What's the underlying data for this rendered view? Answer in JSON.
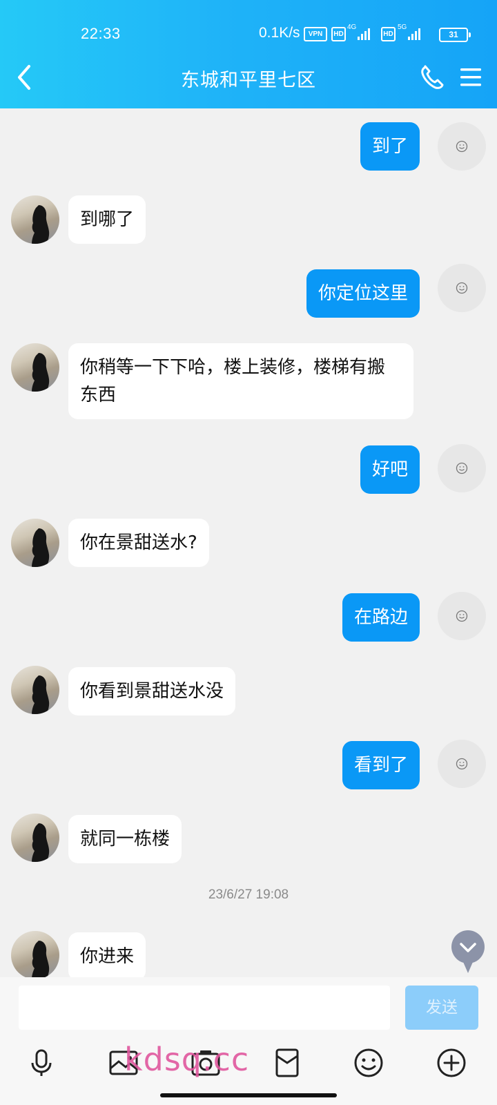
{
  "status_bar": {
    "time": "22:33",
    "net_speed": "0.1K/s",
    "vpn": "VPN",
    "hd1": "HD",
    "net1": "4G",
    "hd2": "HD",
    "net2": "5G",
    "battery": "31"
  },
  "header": {
    "title": "东城和平里七区",
    "back_icon": "chevron-left-icon",
    "call_icon": "phone-icon",
    "menu_icon": "menu-icon"
  },
  "messages": [
    {
      "side": "sent",
      "text": "到了"
    },
    {
      "side": "recv",
      "text": "到哪了"
    },
    {
      "side": "sent",
      "text": "你定位这里"
    },
    {
      "side": "recv",
      "text": "你稍等一下下哈，楼上装修，楼梯有搬东西"
    },
    {
      "side": "sent",
      "text": "好吧"
    },
    {
      "side": "recv",
      "text": "你在景甜送水?"
    },
    {
      "side": "sent",
      "text": "在路边"
    },
    {
      "side": "recv",
      "text": "你看到景甜送水没"
    },
    {
      "side": "sent",
      "text": "看到了"
    },
    {
      "side": "recv",
      "text": "就同一栋楼"
    },
    {
      "side": "time",
      "text": "23/6/27 19:08"
    },
    {
      "side": "recv",
      "text": "你进来"
    }
  ],
  "input": {
    "value": "",
    "placeholder": "",
    "send_label": "发送"
  },
  "toolbar": {
    "icons": [
      "microphone-icon",
      "image-icon",
      "camera-icon",
      "red-packet-icon",
      "emoji-icon",
      "plus-icon"
    ]
  },
  "watermark": "kdsq.cc",
  "colors": {
    "header_start": "#25c9f7",
    "header_end": "#15a4f7",
    "sent_bubble": "#0a98f6",
    "recv_bubble": "#ffffff",
    "send_button": "#8ccdfa",
    "watermark": "#e0579e"
  }
}
